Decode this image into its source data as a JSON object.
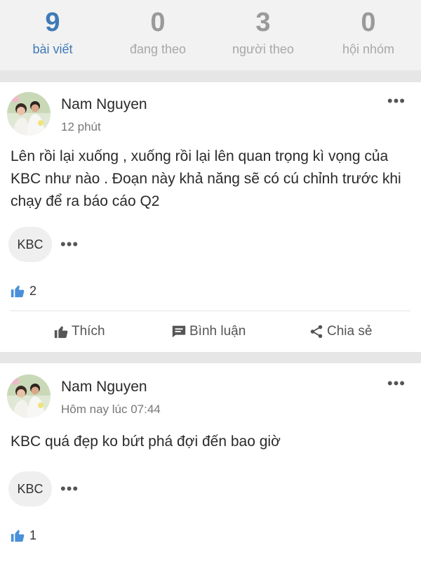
{
  "stats": [
    {
      "value": "9",
      "label": "bài viết"
    },
    {
      "value": "0",
      "label": "đang theo"
    },
    {
      "value": "3",
      "label": "người theo"
    },
    {
      "value": "0",
      "label": "hội nhóm"
    }
  ],
  "posts": [
    {
      "author": "Nam Nguyen",
      "time": "12 phút",
      "content": "Lên rồi lại xuống , xuống rồi lại lên quan trọng kì vọng của KBC như nào . Đoạn này khả năng sẽ có cú chỉnh trước khi chạy để ra báo cáo Q2",
      "tag": "KBC",
      "likes": "2",
      "actions": {
        "like": "Thích",
        "comment": "Bình luận",
        "share": "Chia sẻ"
      }
    },
    {
      "author": "Nam Nguyen",
      "time": "Hôm nay lúc 07:44",
      "content": "KBC quá đẹp ko bứt phá đợi đến bao giờ",
      "tag": "KBC",
      "likes": "1"
    }
  ],
  "colors": {
    "accent": "#3f7ab7",
    "like_icon": "#4a90d9"
  },
  "icons": {
    "menu": "more-dots-icon",
    "like": "thumbs-up-icon",
    "comment": "comment-icon",
    "share": "share-icon"
  }
}
